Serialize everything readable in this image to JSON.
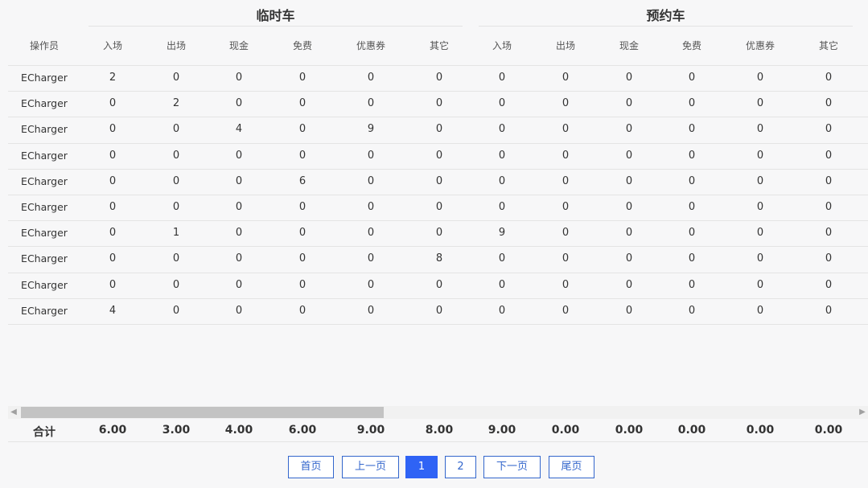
{
  "groups": {
    "temp": "临时车",
    "reserved": "预约车"
  },
  "headers": {
    "operator": "操作员",
    "temp": [
      "入场",
      "出场",
      "现金",
      "免费",
      "优惠券",
      "其它"
    ],
    "reserved": [
      "入场",
      "出场",
      "现金",
      "免费",
      "优惠券",
      "其它"
    ]
  },
  "rows": [
    [
      "ECharger",
      "2",
      "0",
      "0",
      "0",
      "0",
      "0",
      "0",
      "0",
      "0",
      "0",
      "0",
      "0"
    ],
    [
      "ECharger",
      "0",
      "2",
      "0",
      "0",
      "0",
      "0",
      "0",
      "0",
      "0",
      "0",
      "0",
      "0"
    ],
    [
      "ECharger",
      "0",
      "0",
      "4",
      "0",
      "9",
      "0",
      "0",
      "0",
      "0",
      "0",
      "0",
      "0"
    ],
    [
      "ECharger",
      "0",
      "0",
      "0",
      "0",
      "0",
      "0",
      "0",
      "0",
      "0",
      "0",
      "0",
      "0"
    ],
    [
      "ECharger",
      "0",
      "0",
      "0",
      "6",
      "0",
      "0",
      "0",
      "0",
      "0",
      "0",
      "0",
      "0"
    ],
    [
      "ECharger",
      "0",
      "0",
      "0",
      "0",
      "0",
      "0",
      "0",
      "0",
      "0",
      "0",
      "0",
      "0"
    ],
    [
      "ECharger",
      "0",
      "1",
      "0",
      "0",
      "0",
      "0",
      "9",
      "0",
      "0",
      "0",
      "0",
      "0"
    ],
    [
      "ECharger",
      "0",
      "0",
      "0",
      "0",
      "0",
      "8",
      "0",
      "0",
      "0",
      "0",
      "0",
      "0"
    ],
    [
      "ECharger",
      "0",
      "0",
      "0",
      "0",
      "0",
      "0",
      "0",
      "0",
      "0",
      "0",
      "0",
      "0"
    ],
    [
      "ECharger",
      "4",
      "0",
      "0",
      "0",
      "0",
      "0",
      "0",
      "0",
      "0",
      "0",
      "0",
      "0"
    ]
  ],
  "totals": {
    "label": "合计",
    "values": [
      "6.00",
      "3.00",
      "4.00",
      "6.00",
      "9.00",
      "8.00",
      "9.00",
      "0.00",
      "0.00",
      "0.00",
      "0.00",
      "0.00"
    ]
  },
  "pagination": {
    "first": "首页",
    "prev": "上一页",
    "pages": [
      "1",
      "2"
    ],
    "current": "1",
    "next": "下一页",
    "last": "尾页"
  },
  "colors": {
    "accent": "#2f63f5",
    "border": "#3366cc"
  }
}
